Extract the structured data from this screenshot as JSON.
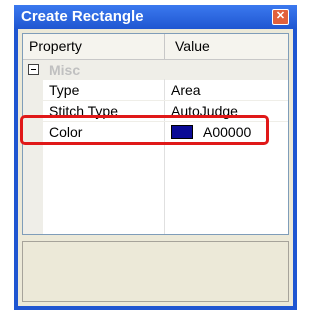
{
  "window": {
    "title": "Create Rectangle"
  },
  "grid": {
    "headers": {
      "property": "Property",
      "value": "Value"
    },
    "category": {
      "label": "Misc",
      "expander": "−"
    },
    "rows": [
      {
        "name": "Type",
        "value": "Area"
      },
      {
        "name": "Stitch Type",
        "value": "AutoJudge"
      },
      {
        "name": "Color",
        "value": "A00000",
        "swatch": "#0a0a96"
      }
    ]
  },
  "icons": {
    "close": "close-icon",
    "collapse": "minus-box-icon"
  },
  "colors": {
    "titlebar": "#1f56d1",
    "highlight": "#e01818",
    "close_button": "#e2603c"
  }
}
